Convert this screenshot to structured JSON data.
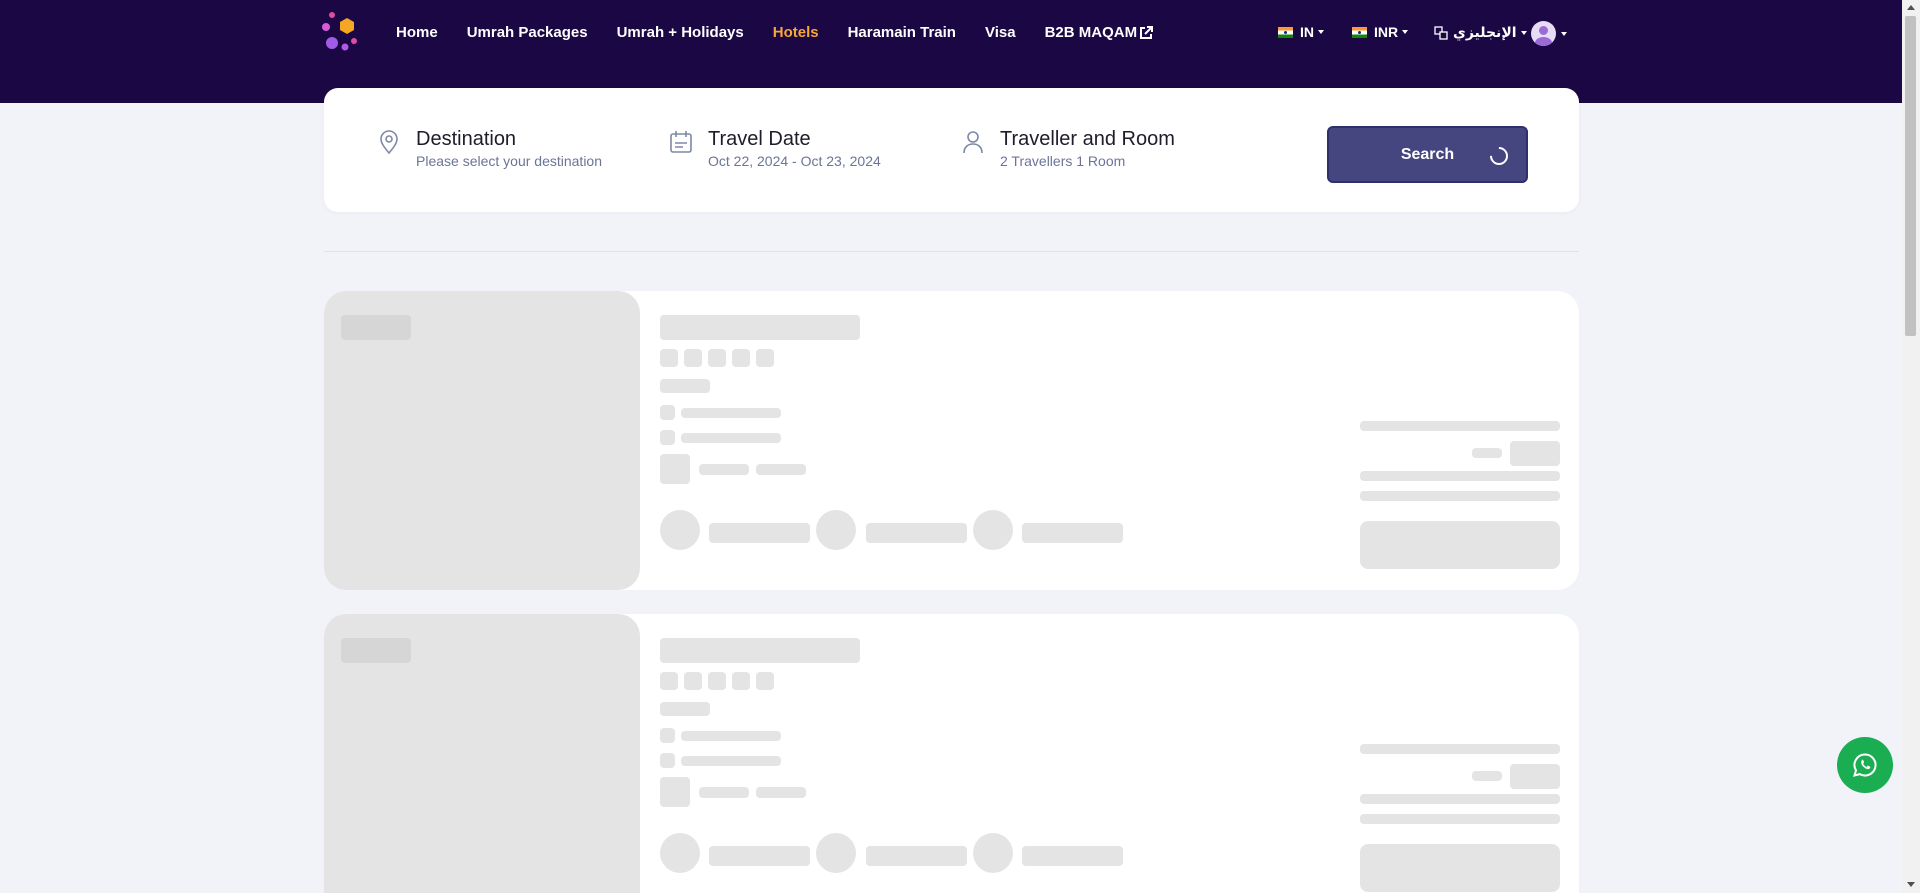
{
  "nav": {
    "items": [
      {
        "label": "Home",
        "active": false
      },
      {
        "label": "Umrah Packages",
        "active": false
      },
      {
        "label": "Umrah + Holidays",
        "active": false
      },
      {
        "label": "Hotels",
        "active": true
      },
      {
        "label": "Haramain Train",
        "active": false
      },
      {
        "label": "Visa",
        "active": false
      },
      {
        "label": "B2B MAQAM",
        "active": false,
        "external": true
      }
    ],
    "country": "IN",
    "currency": "INR",
    "language": "الإنجليزي",
    "logo_icon": "maqam-logo-icon",
    "avatar_icon": "user-avatar-icon"
  },
  "search": {
    "destination": {
      "title": "Destination",
      "value": "Please select your destination",
      "icon": "location-pin-icon"
    },
    "date": {
      "title": "Travel Date",
      "value": "Oct 22, 2024 - Oct 23, 2024",
      "icon": "calendar-icon"
    },
    "traveller": {
      "title": "Traveller and Room",
      "value": "2 Travellers 1 Room",
      "icon": "person-icon"
    },
    "button_label": "Search"
  },
  "colors": {
    "header_bg": "#1a0744",
    "active_nav": "#f7a63a",
    "search_button": "#454680",
    "whatsapp": "#1aad52"
  },
  "results": {
    "state": "loading",
    "skeleton_cards": 2
  },
  "whatsapp": {
    "icon": "whatsapp-icon"
  }
}
